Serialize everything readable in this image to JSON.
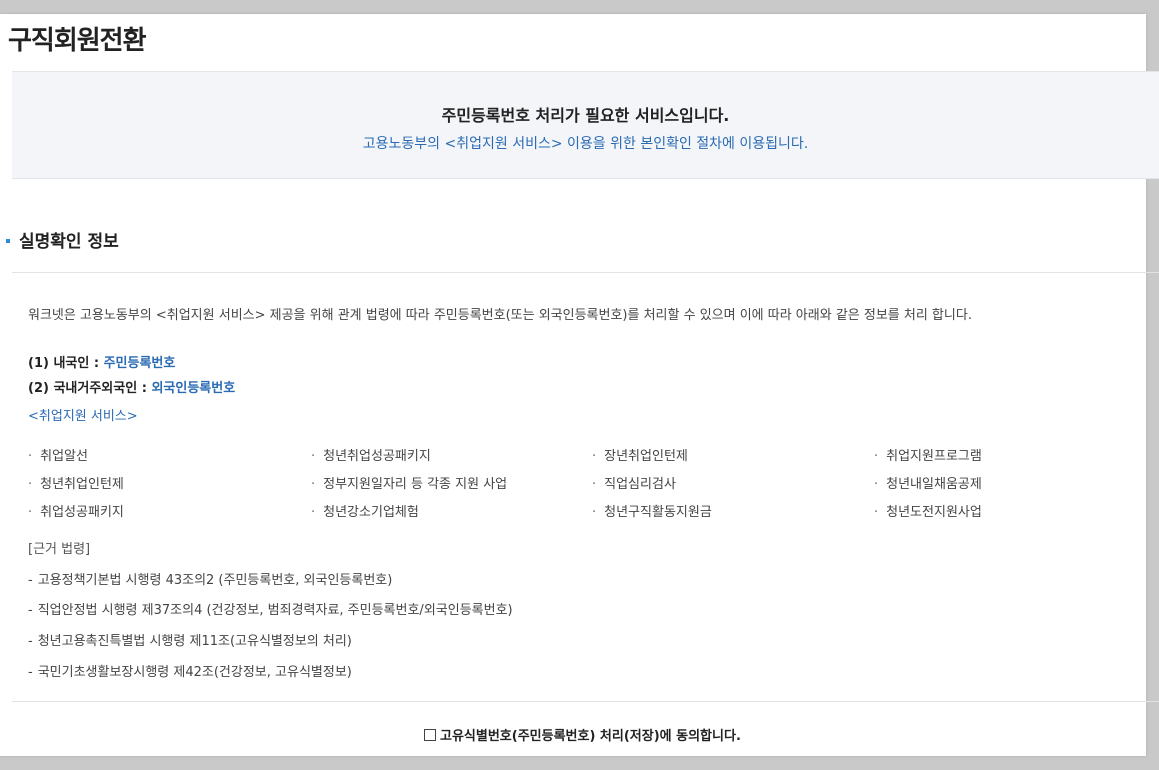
{
  "page": {
    "title": "구직회원전환"
  },
  "notice": {
    "title": "주민등록번호 처리가 필요한 서비스입니다.",
    "subtitle": "고용노동부의 <취업지원 서비스> 이용을 위한 본인확인 절차에 이용됩니다."
  },
  "section": {
    "title": "실명확인 정보"
  },
  "info": {
    "intro": "워크넷은 고용노동부의 <취업지원 서비스> 제공을 위해 관계 법령에 따라 주민등록번호(또는 외국인등록번호)를 처리할 수 있으며 이에 따라 아래와 같은 정보를 처리 합니다.",
    "rows": [
      {
        "label": "(1) 내국인 : ",
        "value": "주민등록번호"
      },
      {
        "label": "(2) 국내거주외국인 : ",
        "value": "외국인등록번호"
      }
    ],
    "services_title": "<취업지원 서비스>",
    "services": [
      "취업알선",
      "청년취업성공패키지",
      "장년취업인턴제",
      "취업지원프로그램",
      "청년취업인턴제",
      "정부지원일자리 등 각종 지원 사업",
      "직업심리검사",
      "청년내일채움공제",
      "취업성공패키지",
      "청년강소기업체험",
      "청년구직활동지원금",
      "청년도전지원사업"
    ],
    "law_title": "[근거 법령]",
    "laws": [
      "고용정책기본법 시행령 43조의2 (주민등록번호, 외국인등록번호)",
      "직업안정법 시행령 제37조의4 (건강정보, 범죄경력자료, 주민등록번호/외국인등록번호)",
      "청년고용촉진특별법 시행령 제11조(고유식별정보의 처리)",
      "국민기초생활보장시행령 제42조(건강정보, 고유식별정보)"
    ]
  },
  "agree": {
    "label": "고유식별번호(주민등록번호) 처리(저장)에 동의합니다.",
    "checked": false
  },
  "colors": {
    "accent": "#2a6bb4",
    "bullet": "#2a8bd6",
    "notice_bg": "#f3f5f8"
  },
  "icons": {
    "checkbox": "checkbox-icon",
    "section_bullet": "square-bullet-icon"
  }
}
